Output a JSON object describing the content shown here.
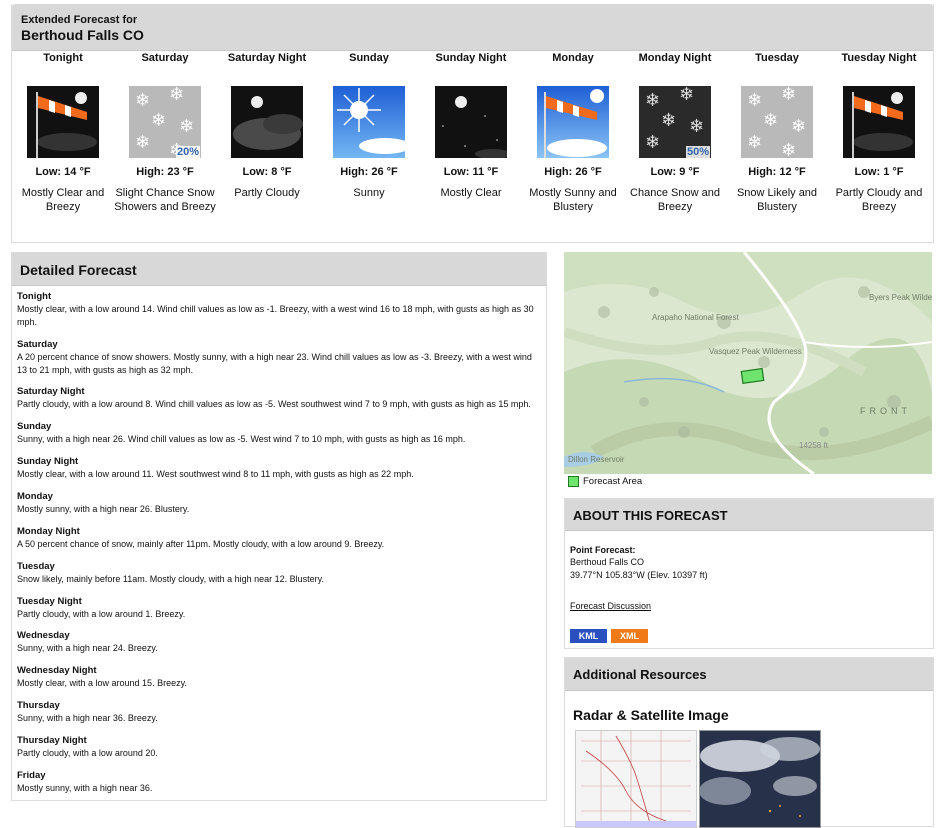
{
  "extended": {
    "label": "Extended Forecast for",
    "location": "Berthoud Falls CO",
    "periods": [
      {
        "name": "Tonight",
        "temp": "Low: 14 °F",
        "short": "Mostly Clear and Breezy",
        "icon": "night-wind-icon",
        "pop": ""
      },
      {
        "name": "Saturday",
        "temp": "High: 23 °F",
        "short": "Slight Chance Snow Showers and Breezy",
        "icon": "snow-icon",
        "pop": "20%"
      },
      {
        "name": "Saturday Night",
        "temp": "Low: 8 °F",
        "short": "Partly Cloudy",
        "icon": "night-cloudy-icon",
        "pop": ""
      },
      {
        "name": "Sunday",
        "temp": "High: 26 °F",
        "short": "Sunny",
        "icon": "sunny-icon",
        "pop": ""
      },
      {
        "name": "Sunday Night",
        "temp": "Low: 11 °F",
        "short": "Mostly Clear",
        "icon": "night-clear-icon",
        "pop": ""
      },
      {
        "name": "Monday",
        "temp": "High: 26 °F",
        "short": "Mostly Sunny and Blustery",
        "icon": "day-wind-icon",
        "pop": ""
      },
      {
        "name": "Monday Night",
        "temp": "Low: 9 °F",
        "short": "Chance Snow and Breezy",
        "icon": "night-snow-icon",
        "pop": "50%"
      },
      {
        "name": "Tuesday",
        "temp": "High: 12 °F",
        "short": "Snow Likely and Blustery",
        "icon": "snow-icon",
        "pop": ""
      },
      {
        "name": "Tuesday Night",
        "temp": "Low: 1 °F",
        "short": "Partly Cloudy and Breezy",
        "icon": "night-wind-icon",
        "pop": ""
      }
    ]
  },
  "detailed": {
    "title": "Detailed Forecast",
    "rows": [
      {
        "label": "Tonight",
        "text": "Mostly clear, with a low around 14. Wind chill values as low as -1. Breezy, with a west wind 16 to 18 mph, with gusts as high as 30 mph."
      },
      {
        "label": "Saturday",
        "text": "A 20 percent chance of snow showers. Mostly sunny, with a high near 23. Wind chill values as low as -3. Breezy, with a west wind 13 to 21 mph, with gusts as high as 32 mph."
      },
      {
        "label": "Saturday Night",
        "text": "Partly cloudy, with a low around 8. Wind chill values as low as -5. West southwest wind 7 to 9 mph, with gusts as high as 15 mph."
      },
      {
        "label": "Sunday",
        "text": "Sunny, with a high near 26. Wind chill values as low as -5. West wind 7 to 10 mph, with gusts as high as 16 mph."
      },
      {
        "label": "Sunday Night",
        "text": "Mostly clear, with a low around 11. West southwest wind 8 to 11 mph, with gusts as high as 22 mph."
      },
      {
        "label": "Monday",
        "text": "Mostly sunny, with a high near 26. Blustery."
      },
      {
        "label": "Monday Night",
        "text": "A 50 percent chance of snow, mainly after 11pm. Mostly cloudy, with a low around 9. Breezy."
      },
      {
        "label": "Tuesday",
        "text": "Snow likely, mainly before 11am. Mostly cloudy, with a high near 12. Blustery."
      },
      {
        "label": "Tuesday Night",
        "text": "Partly cloudy, with a low around 1. Breezy."
      },
      {
        "label": "Wednesday",
        "text": "Sunny, with a high near 24. Breezy."
      },
      {
        "label": "Wednesday Night",
        "text": "Mostly clear, with a low around 15. Breezy."
      },
      {
        "label": "Thursday",
        "text": "Sunny, with a high near 36. Breezy."
      },
      {
        "label": "Thursday Night",
        "text": "Partly cloudy, with a low around 20."
      },
      {
        "label": "Friday",
        "text": "Mostly sunny, with a high near 36."
      }
    ]
  },
  "map": {
    "labels": [
      "Arapaho National Forest",
      "Vasquez Peak Wilderness",
      "Byers Peak Wilderness",
      "FRONT",
      "14258 ft",
      "Dillon Reservoir"
    ],
    "legend": "Forecast Area",
    "area_color": "#6ee36e"
  },
  "about": {
    "title": "ABOUT THIS FORECAST",
    "point_label": "Point Forecast:",
    "location": "Berthoud Falls CO",
    "coords": "39.77°N 105.83°W (Elev. 10397 ft)",
    "discussion_link": "Forecast Discussion",
    "kml": "KML",
    "xml": "XML"
  },
  "additional": {
    "title": "Additional Resources",
    "radar_title": "Radar & Satellite Image"
  },
  "colors": {
    "header_bg": "#d8d8d8",
    "kml_blue": "#2a4fbf",
    "xml_orange": "#f07a18"
  }
}
